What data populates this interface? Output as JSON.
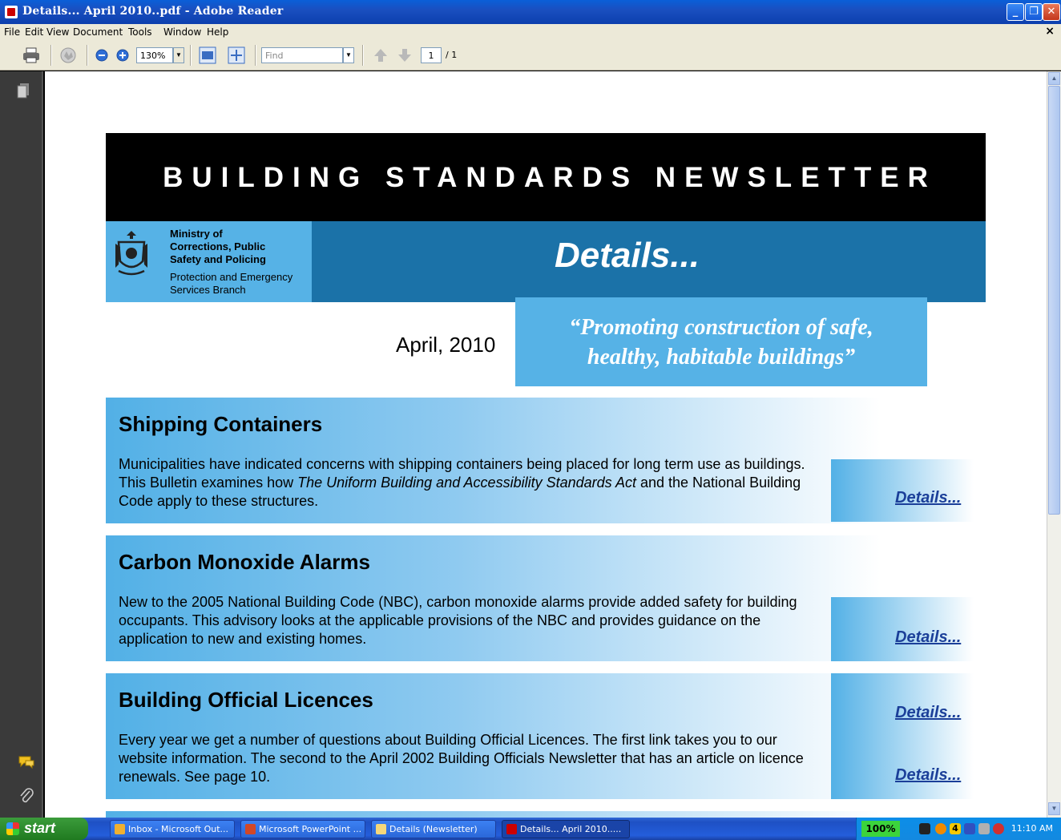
{
  "window": {
    "title": "Details... April 2010..pdf - Adobe Reader",
    "minimize_label": "_",
    "restore_label": "❐",
    "close_label": "✕"
  },
  "menu": {
    "items": [
      "File",
      "Edit",
      "View",
      "Document",
      "Tools",
      "Window",
      "Help"
    ],
    "close_doc": "×"
  },
  "toolbar": {
    "zoom_value": "130%",
    "find_placeholder": "Find",
    "page_current": "1",
    "page_total": "/ 1"
  },
  "document": {
    "banner_title": "BUILDING STANDARDS NEWSLETTER",
    "ministry_line1": "Ministry of",
    "ministry_line2": "Corrections, Public",
    "ministry_line3": "Safety and Policing",
    "branch_line1": "Protection and Emergency",
    "branch_line2": "Services Branch",
    "details_big": "Details...",
    "date": "April, 2010",
    "slogan_line1": "“Promoting construction of safe,",
    "slogan_line2": "healthy, habitable buildings”",
    "articles": [
      {
        "heading": "Shipping Containers",
        "body_before": "Municipalities have indicated concerns with shipping containers being placed for long term use as buildings.  This Bulletin examines how ",
        "body_italic": "The Uniform Building and Accessibility Standards Act",
        "body_after": " and the National Building Code apply to these structures.",
        "link1": "Details..."
      },
      {
        "heading": "Carbon Monoxide Alarms",
        "body": "New to the 2005 National Building Code (NBC), carbon monoxide alarms provide added safety for building occupants.  This advisory looks at the applicable provisions of the NBC and provides guidance on the application to new and existing homes.",
        "link1": "Details..."
      },
      {
        "heading": "Building Official Licences",
        "body": "Every year we get a number of questions about Building Official Licences.  The first link takes you to our website information.   The second to the April 2002 Building Officials Newsletter that has an article on licence renewals.  See page 10.",
        "link1": "Details...",
        "link2": "Details..."
      }
    ]
  },
  "taskbar": {
    "start_label": "start",
    "tasks": [
      "Inbox - Microsoft Out...",
      "Microsoft PowerPoint ...",
      "Details (Newsletter)",
      "Details... April 2010....."
    ],
    "battery": "100%",
    "tray_count": "4",
    "clock": "11:10 AM"
  },
  "colors": {
    "banner_black": "#000000",
    "light_blue": "#56b2e6",
    "dark_blue": "#1b72a8",
    "link_blue": "#1b3f99"
  }
}
